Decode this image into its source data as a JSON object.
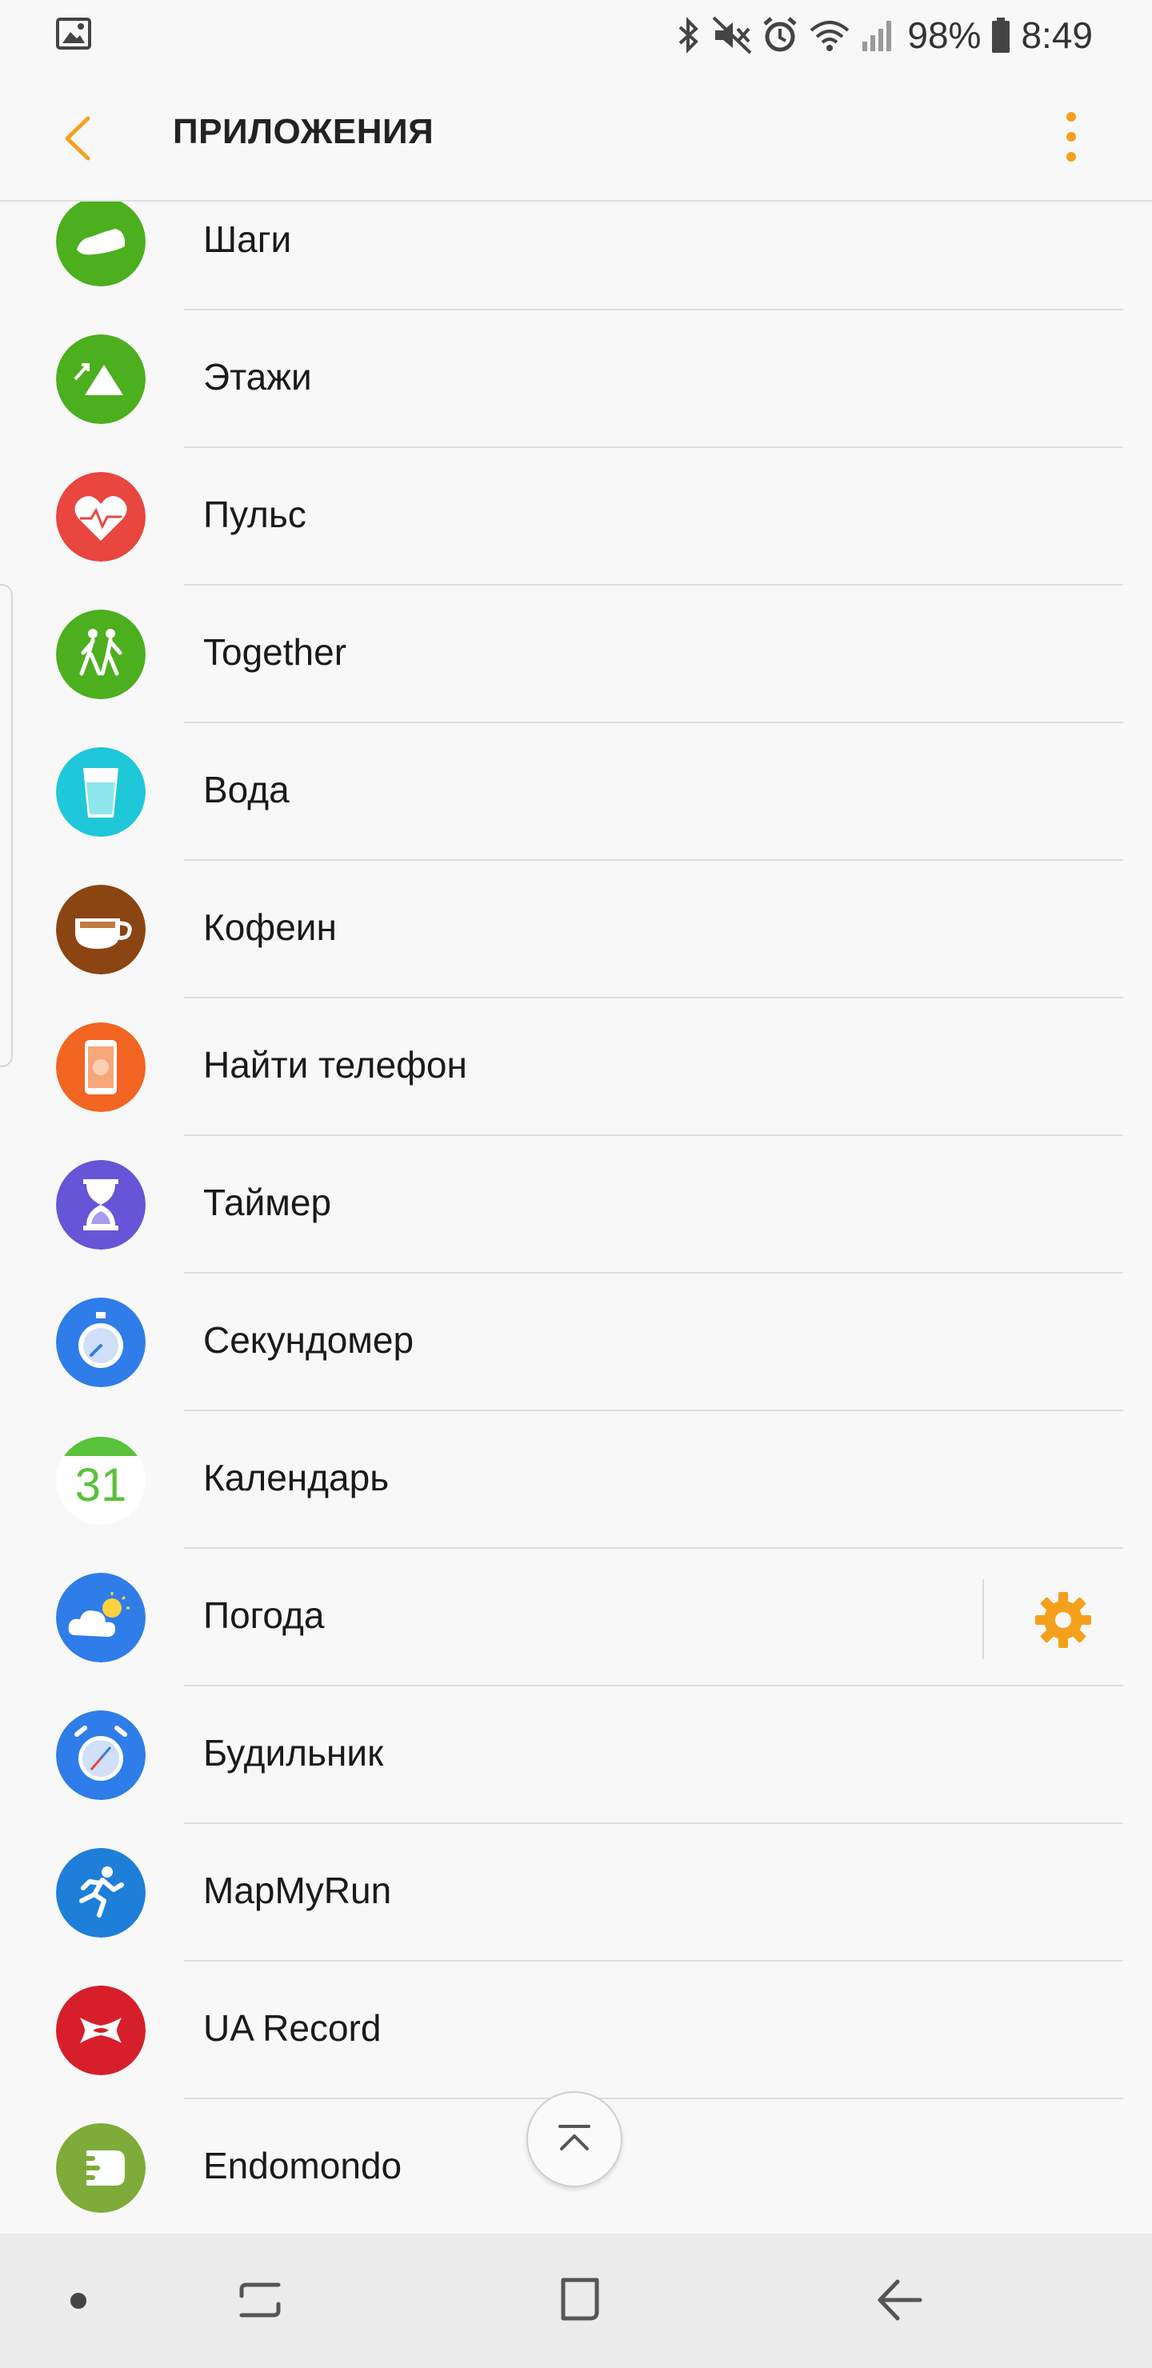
{
  "status_bar": {
    "battery": "98%",
    "time": "8:49"
  },
  "app_bar": {
    "title": "ПРИЛОЖЕНИЯ"
  },
  "colors": {
    "accent": "#f5a01d",
    "divider": "#dddddd"
  },
  "apps": [
    {
      "label": "Шаги",
      "icon": "shoe-icon",
      "color": "#4caf1e"
    },
    {
      "label": "Этажи",
      "icon": "mountain-icon",
      "color": "#4caf1e"
    },
    {
      "label": "Пульс",
      "icon": "heart-icon",
      "color": "#e8463f"
    },
    {
      "label": "Together",
      "icon": "walking-people-icon",
      "color": "#4caf1e"
    },
    {
      "label": "Вода",
      "icon": "water-glass-icon",
      "color": "#1fc8d8"
    },
    {
      "label": "Кофеин",
      "icon": "coffee-cup-icon",
      "color": "#8b4513"
    },
    {
      "label": "Найти телефон",
      "icon": "phone-icon",
      "color": "#f26522"
    },
    {
      "label": "Таймер",
      "icon": "hourglass-icon",
      "color": "#6655d6"
    },
    {
      "label": "Секундомер",
      "icon": "stopwatch-icon",
      "color": "#2f7de8"
    },
    {
      "label": "Календарь",
      "icon": "calendar-icon",
      "color": "#58c23a",
      "calendar_day": "31"
    },
    {
      "label": "Погода",
      "icon": "weather-icon",
      "color": "#2f7de8",
      "has_settings": true
    },
    {
      "label": "Будильник",
      "icon": "alarm-clock-icon",
      "color": "#2f7de8"
    },
    {
      "label": "MapMyRun",
      "icon": "runner-icon",
      "color": "#1e7fd8"
    },
    {
      "label": "UA Record",
      "icon": "under-armour-icon",
      "color": "#d71f2b"
    },
    {
      "label": "Endomondo",
      "icon": "endomondo-icon",
      "color": "#7fab3a"
    }
  ]
}
